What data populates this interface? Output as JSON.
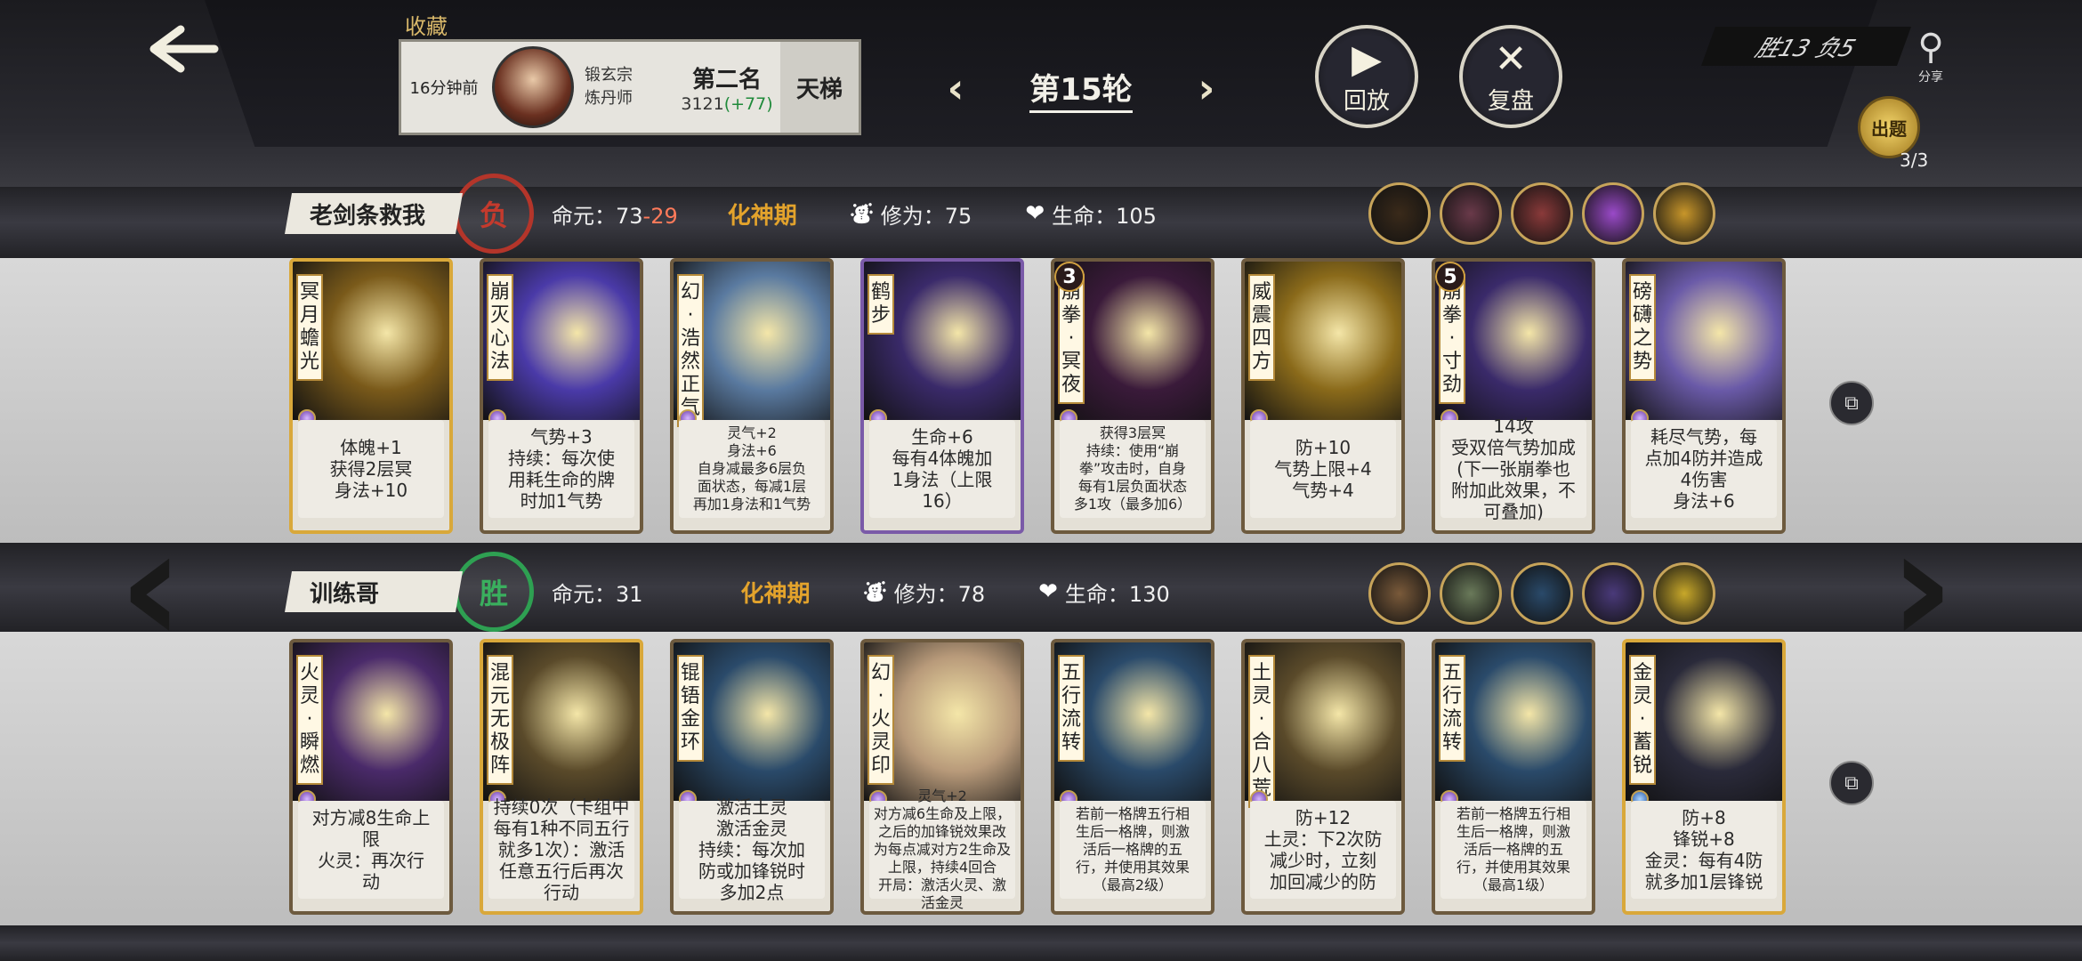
{
  "header": {
    "favorites_label": "收藏",
    "opponent": {
      "time_ago": "16分钟前",
      "sect": "锻玄宗",
      "profession": "炼丹师",
      "rank": "第二名",
      "score": "3121",
      "score_change": "(+77)",
      "mode": "天梯"
    },
    "round_title": "第15轮",
    "replay_label": "回放",
    "review_label": "复盘",
    "record": "胜13 负5",
    "share_label": "分享",
    "quest_label": "出题",
    "quest_count": "3/3"
  },
  "players": [
    {
      "name": "老剑条救我",
      "result": "负",
      "life_label": "命元：",
      "life": "73",
      "life_loss": "-29",
      "realm": "化神期",
      "cultivation_label": "修为：",
      "cultivation": "75",
      "hp_label": "生命：",
      "hp": "105",
      "skill_colors": [
        "#3a2a1a",
        "#6a3a4a",
        "#8a3a3a",
        "#9a4ac8",
        "#c8962a"
      ],
      "cards": [
        {
          "name": "冥月蟾光",
          "desc": "体魄+1\n获得2层冥\n身法+10",
          "art": "#7a5a1a",
          "style": "gold",
          "badge": ""
        },
        {
          "name": "崩灭心法",
          "desc": "气势+3\n持续：每次使\n用耗生命的牌\n时加1气势",
          "art": "#4a3aa8",
          "style": "",
          "badge": ""
        },
        {
          "name": "幻·浩然正气",
          "desc": "灵气+2\n身法+6\n自身减最多6层负\n面状态，每减1层\n再加1身法和1气势",
          "art": "#5a7aa0",
          "style": "",
          "badge": "",
          "small": true
        },
        {
          "name": "鹤步",
          "desc": "生命+6\n每有4体魄加\n1身法（上限\n16）",
          "art": "#3a2a6a",
          "style": "purple",
          "badge": ""
        },
        {
          "name": "崩拳·冥夜",
          "desc": "获得3层冥\n持续：使用“崩\n拳”攻击时，自身\n每有1层负面状态\n多1攻（最多加6）",
          "art": "#3a1a3a",
          "style": "",
          "badge": "3",
          "small": true
        },
        {
          "name": "威震四方",
          "desc": "防+10\n气势上限+4\n气势+4",
          "art": "#8a6a1a",
          "style": "",
          "badge": ""
        },
        {
          "name": "崩拳·寸劲",
          "desc": "14攻\n受双倍气势加成\n(下一张崩拳也\n附加此效果，不\n可叠加)",
          "art": "#3a2a6a",
          "style": "",
          "badge": "5"
        },
        {
          "name": "磅礴之势",
          "desc": "耗尽气势，每\n点加4防并造成\n4伤害\n身法+6",
          "art": "#6a5aa8",
          "style": "",
          "badge": ""
        }
      ]
    },
    {
      "name": "训练哥",
      "result": "胜",
      "life_label": "命元：",
      "life": "31",
      "life_loss": "",
      "realm": "化神期",
      "cultivation_label": "修为：",
      "cultivation": "78",
      "hp_label": "生命：",
      "hp": "130",
      "skill_colors": [
        "#7a5a3a",
        "#6a7a5a",
        "#2a4a6a",
        "#4a3a7a",
        "#c8a82a"
      ],
      "cards": [
        {
          "name": "火灵·瞬燃",
          "desc": "对方减8生命上\n限\n火灵：再次行\n动",
          "art": "#4a2a6a",
          "style": "",
          "badge": ""
        },
        {
          "name": "混元无极阵",
          "desc": "持续0次（卡组中\n每有1种不同五行\n就多1次）：激活\n任意五行后再次\n行动",
          "art": "#5a4a2a",
          "style": "gold",
          "badge": ""
        },
        {
          "name": "锟铻金环",
          "desc": "激活土灵\n激活金灵\n持续：每次加\n防或加锋锐时\n多加2点",
          "art": "#2a4a6a",
          "style": "",
          "badge": ""
        },
        {
          "name": "幻·火灵印",
          "desc": "灵气+2\n对方减6生命及上限，\n之后的加锋锐效果改\n为每点减对方2生命及\n上限，持续4回合\n开局：激活火灵、激\n活金灵",
          "art": "#b89a7a",
          "style": "",
          "badge": "",
          "small": true
        },
        {
          "name": "五行流转",
          "desc": "若前一格牌五行相\n生后一格牌，则激\n活后一格牌的五\n行，并使用其效果\n（最高2级）",
          "art": "#2a4a6a",
          "style": "",
          "badge": "",
          "small": true
        },
        {
          "name": "土灵·合八荒",
          "desc": "防+12\n土灵：下2次防\n减少时，立刻\n加回减少的防",
          "art": "#5a4a2a",
          "style": "",
          "badge": ""
        },
        {
          "name": "五行流转",
          "desc": "若前一格牌五行相\n生后一格牌，则激\n活后一格牌的五\n行，并使用其效果\n（最高1级）",
          "art": "#2a4a6a",
          "style": "",
          "badge": "",
          "small": true
        },
        {
          "name": "金灵·蓄锐",
          "desc": "防+8\n锋锐+8\n金灵：每有4防\n就多加1层锋锐",
          "art": "#2a2a3a",
          "style": "gold",
          "badge": ""
        }
      ]
    }
  ]
}
